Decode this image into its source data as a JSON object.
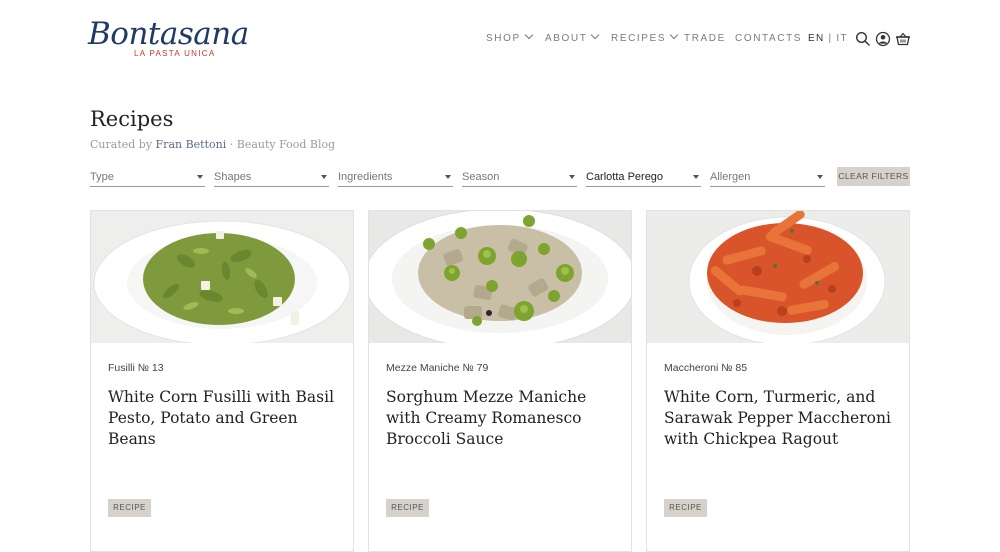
{
  "brand": {
    "name": "Bontasana",
    "tagline": "LA PASTA UNICA",
    "color": "#1f3a63",
    "accent": "#c0392b"
  },
  "nav": {
    "items": [
      {
        "label": "SHOP",
        "has_dropdown": true
      },
      {
        "label": "ABOUT",
        "has_dropdown": true
      },
      {
        "label": "RECIPES",
        "has_dropdown": true
      },
      {
        "label": "TRADE",
        "has_dropdown": false
      },
      {
        "label": "CONTACTS",
        "has_dropdown": false
      }
    ],
    "lang_active": "EN",
    "lang_separator": "|",
    "lang_other": "IT",
    "icons": [
      "search-icon",
      "account-icon",
      "cart-icon"
    ]
  },
  "page": {
    "title": "Recipes",
    "curated_prefix": "Curated by",
    "curator": "Fran Bettoni",
    "curated_suffix": "· Beauty Food Blog"
  },
  "filters": [
    {
      "label": "Type",
      "selected": false
    },
    {
      "label": "Shapes",
      "selected": false
    },
    {
      "label": "Ingredients",
      "selected": false
    },
    {
      "label": "Season",
      "selected": false
    },
    {
      "label": "Carlotta Perego",
      "selected": true
    },
    {
      "label": "Allergen",
      "selected": false
    }
  ],
  "clear_filters_label": "CLEAR FILTERS",
  "recipes": [
    {
      "code": "Fusilli № 13",
      "title": "White Corn Fusilli with Basil Pesto, Potato and Green Beans",
      "badge": "RECIPE",
      "pasta_color": "#7e9a3c"
    },
    {
      "code": "Mezze Maniche № 79",
      "title": "Sorghum Mezze Maniche with Creamy Romanesco Broccoli Sauce",
      "badge": "RECIPE",
      "pasta_color": "#c9bea6"
    },
    {
      "code": "Maccheroni № 85",
      "title": "White Corn, Turmeric, and Sarawak Pepper Maccheroni with Chickpea Ragout",
      "badge": "RECIPE",
      "pasta_color": "#d9542a"
    }
  ]
}
